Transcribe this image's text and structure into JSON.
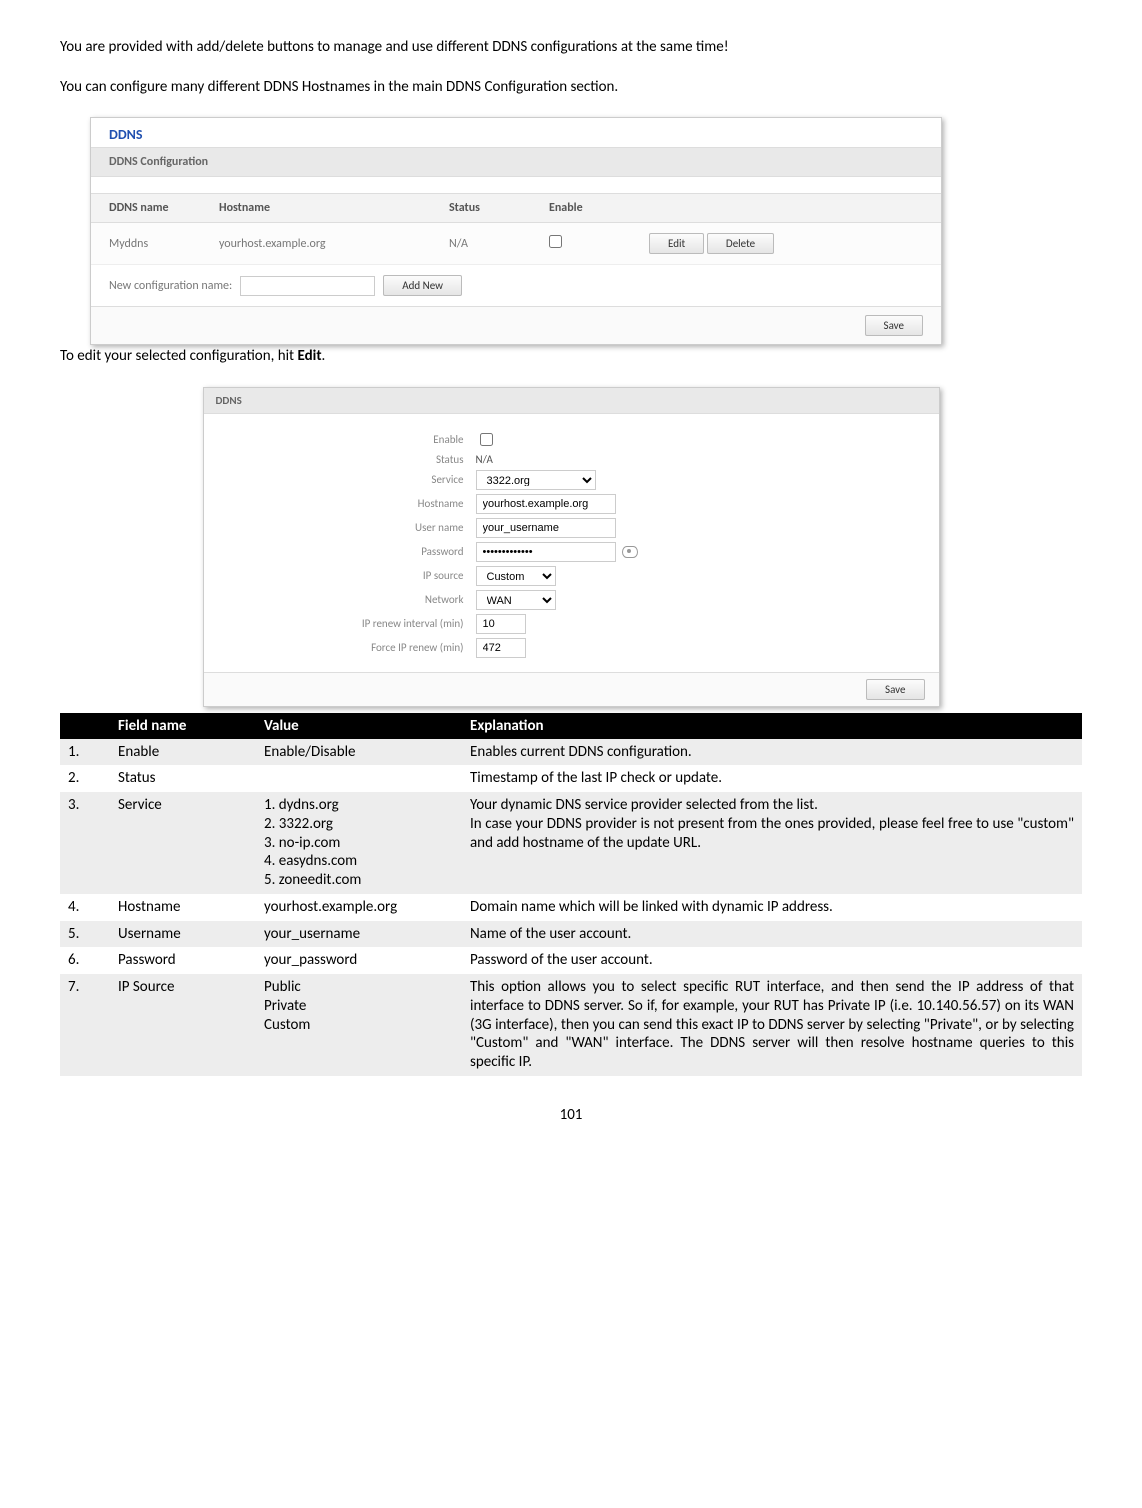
{
  "intro1": "You are provided with add/delete buttons to manage and use different DDNS configurations at the same time!",
  "intro2": "You can configure many different DDNS Hostnames in the main DDNS Configuration section.",
  "edit_line_a": "To edit your selected configuration, hit ",
  "edit_line_b": "Edit",
  "edit_line_c": ".",
  "page_number": "101",
  "shot1": {
    "title": "DDNS",
    "subhead": "DDNS Configuration",
    "cols": {
      "name": "DDNS name",
      "host": "Hostname",
      "status": "Status",
      "enable": "Enable"
    },
    "row": {
      "name": "Myddns",
      "host": "yourhost.example.org",
      "status": "N/A"
    },
    "edit": "Edit",
    "delete": "Delete",
    "newlabel": "New configuration name:",
    "addnew": "Add New",
    "save": "Save"
  },
  "shot2": {
    "title": "DDNS",
    "labels": {
      "enable": "Enable",
      "status": "Status",
      "service": "Service",
      "hostname": "Hostname",
      "username": "User name",
      "password": "Password",
      "ipsource": "IP source",
      "network": "Network",
      "iprenew": "IP renew interval (min)",
      "forceip": "Force IP renew (min)"
    },
    "values": {
      "status": "N/A",
      "service": "3322.org",
      "hostname": "yourhost.example.org",
      "username": "your_username",
      "password": "•••••••••••••",
      "ipsource": "Custom",
      "network": "WAN",
      "iprenew": "10",
      "forceip": "472"
    },
    "save": "Save"
  },
  "table": {
    "headers": {
      "num": "",
      "field": "Field name",
      "value": "Value",
      "explanation": "Explanation"
    },
    "rows": [
      {
        "n": "1.",
        "field": "Enable",
        "value": "Enable/Disable",
        "exp": "Enables current DDNS configuration."
      },
      {
        "n": "2.",
        "field": "Status",
        "value": "",
        "exp": "Timestamp of the last IP check or update."
      },
      {
        "n": "3.",
        "field": "Service",
        "value": "1. dydns.org\n2. 3322.org\n3. no-ip.com\n4. easydns.com\n5. zoneedit.com\n",
        "exp": "Your dynamic DNS service provider selected from the list.\nIn case your DDNS provider is not present from the ones provided, please feel free to use \"custom\" and add hostname of the update URL."
      },
      {
        "n": "4.",
        "field": "Hostname",
        "value": "yourhost.example.org",
        "exp": "Domain name which will be linked with dynamic IP address."
      },
      {
        "n": "5.",
        "field": "Username",
        "value": "your_username",
        "exp": "Name of the user account."
      },
      {
        "n": "6.",
        "field": "Password",
        "value": "your_password",
        "exp": "Password of the user account."
      },
      {
        "n": "7.",
        "field": "IP Source",
        "value": "Public\nPrivate\nCustom",
        "exp": "This option allows you to select specific RUT interface, and then send the IP address of that interface to DDNS server. So if, for example, your RUT has Private IP (i.e. 10.140.56.57) on its WAN (3G interface), then you can send this exact IP to DDNS server by selecting \"Private\", or by selecting \"Custom\" and \"WAN\" interface. The DDNS server will then resolve hostname queries to this specific IP."
      }
    ]
  }
}
